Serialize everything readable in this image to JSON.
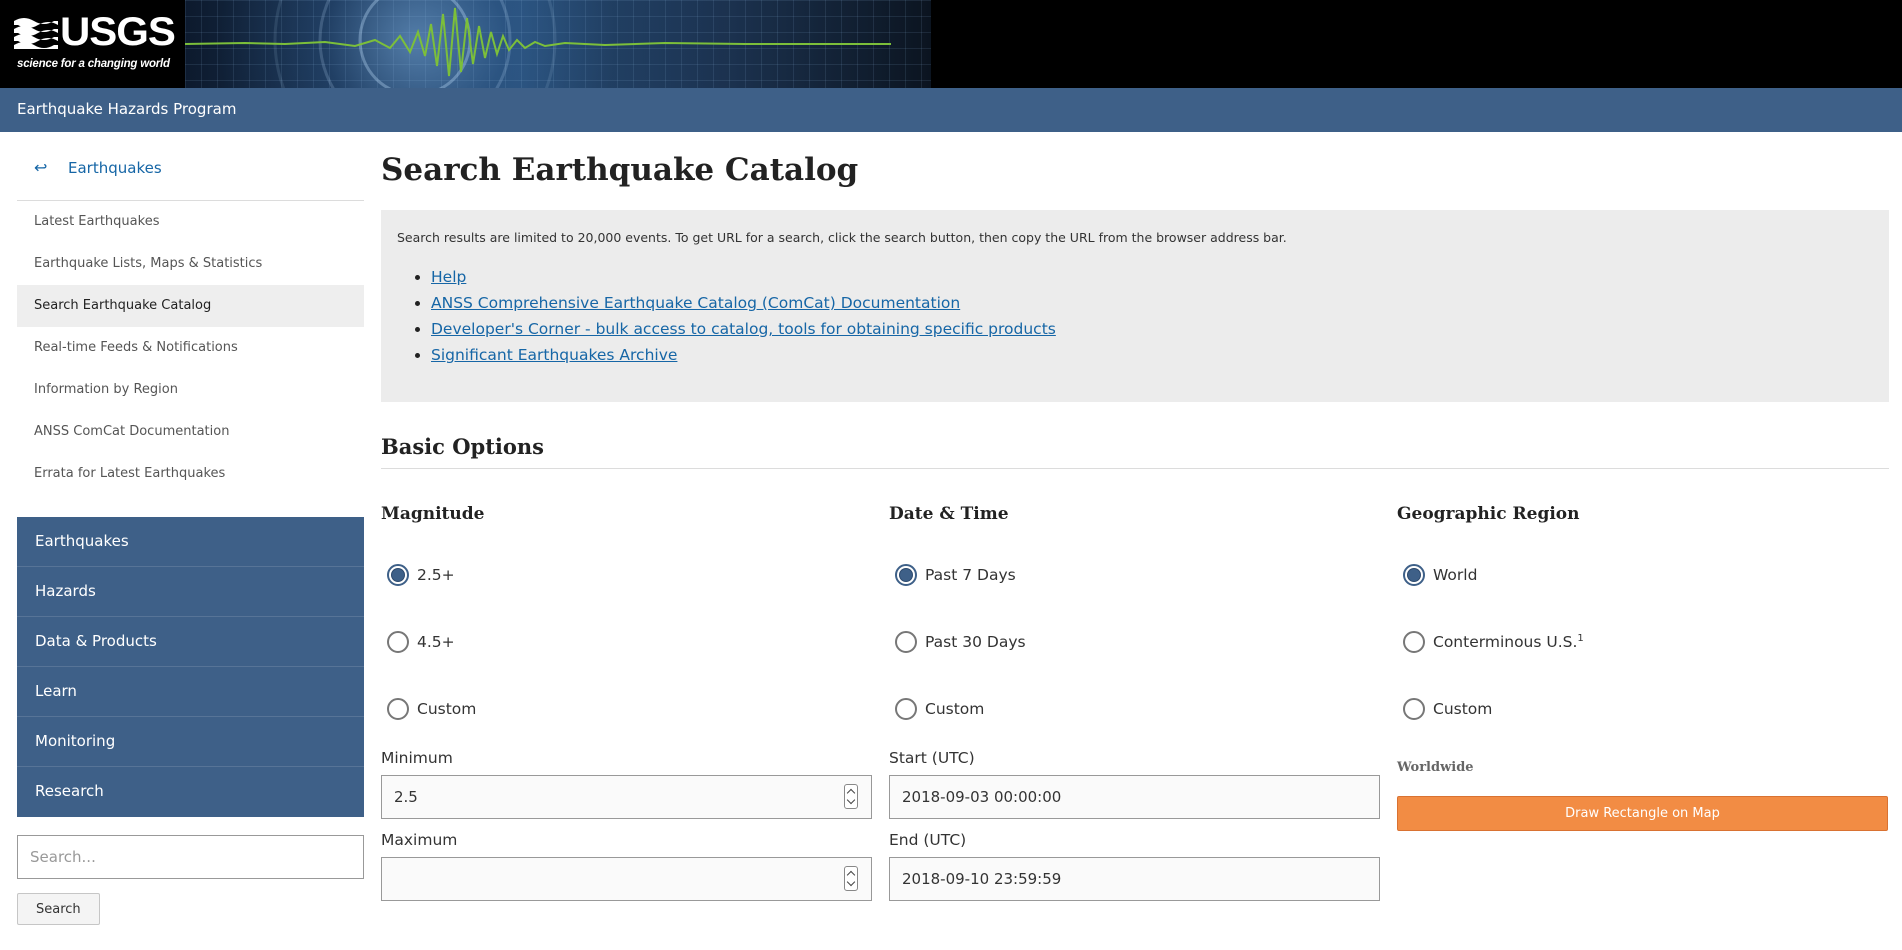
{
  "header": {
    "logo_title": "USGS",
    "logo_tagline": "science for a changing world",
    "program_name": "Earthquake Hazards Program"
  },
  "sidebar": {
    "back_icon": "back-arrow-icon",
    "back_glyph": "↩",
    "back_label": "Earthquakes",
    "items": [
      {
        "label": "Latest Earthquakes"
      },
      {
        "label": "Earthquake Lists, Maps & Statistics"
      },
      {
        "label": "Search Earthquake Catalog"
      },
      {
        "label": "Real-time Feeds & Notifications"
      },
      {
        "label": "Information by Region"
      },
      {
        "label": "ANSS ComCat Documentation"
      },
      {
        "label": "Errata for Latest Earthquakes"
      }
    ],
    "active_item": "Search Earthquake Catalog",
    "sections": [
      {
        "label": "Earthquakes"
      },
      {
        "label": "Hazards"
      },
      {
        "label": "Data & Products"
      },
      {
        "label": "Learn"
      },
      {
        "label": "Monitoring"
      },
      {
        "label": "Research"
      }
    ],
    "search_placeholder": "Search...",
    "search_button": "Search"
  },
  "main": {
    "title": "Search Earthquake Catalog",
    "info_text": "Search results are limited to 20,000 events. To get URL for a search, click the search button, then copy the URL from the browser address bar.",
    "links": [
      {
        "label": "Help"
      },
      {
        "label": "ANSS Comprehensive Earthquake Catalog (ComCat) Documentation"
      },
      {
        "label": "Developer's Corner - bulk access to catalog, tools for obtaining specific products"
      },
      {
        "label": "Significant Earthquakes Archive"
      }
    ],
    "section_title": "Basic Options"
  },
  "magnitude": {
    "heading": "Magnitude",
    "options": [
      {
        "label": "2.5+",
        "checked": true
      },
      {
        "label": "4.5+",
        "checked": false
      },
      {
        "label": "Custom",
        "checked": false
      }
    ],
    "min_label": "Minimum",
    "min_value": "2.5",
    "max_label": "Maximum",
    "max_value": ""
  },
  "datetime": {
    "heading": "Date & Time",
    "options": [
      {
        "label": "Past 7 Days",
        "checked": true
      },
      {
        "label": "Past 30 Days",
        "checked": false
      },
      {
        "label": "Custom",
        "checked": false
      }
    ],
    "start_label": "Start (UTC)",
    "start_value": "2018-09-03 00:00:00",
    "end_label": "End (UTC)",
    "end_value": "2018-09-10 23:59:59"
  },
  "region": {
    "heading": "Geographic Region",
    "options": [
      {
        "label": "World",
        "checked": true
      },
      {
        "label": "Conterminous U.S.",
        "sup": "1",
        "checked": false
      },
      {
        "label": "Custom",
        "checked": false
      }
    ],
    "note": "Worldwide",
    "map_button": "Draw Rectangle on Map"
  },
  "colors": {
    "brand_blue": "#3e6088",
    "link_blue": "#1666a6",
    "accent_orange": "#f28c44"
  }
}
